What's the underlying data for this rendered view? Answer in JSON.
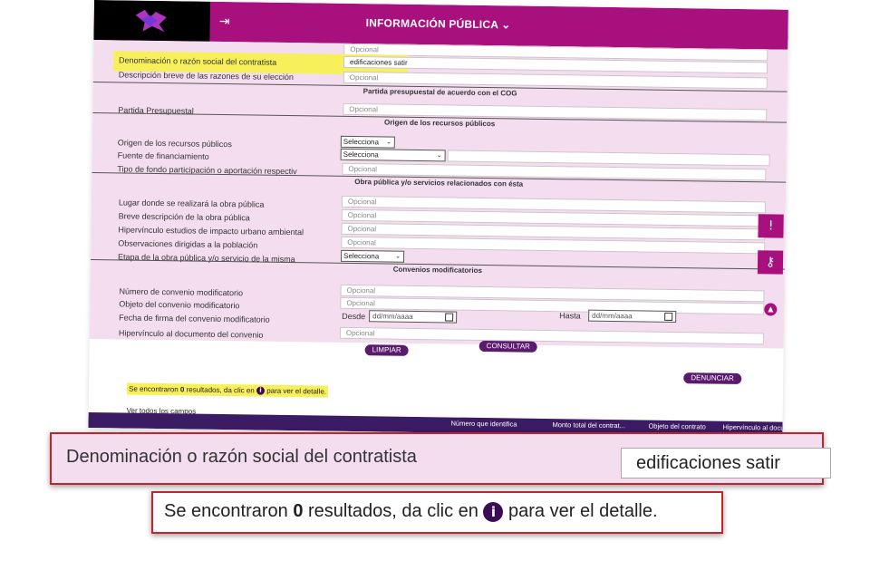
{
  "header": {
    "title": "INFORMACIÓN PÚBLICA",
    "title_chevron": "⌄",
    "login_icon": "login-icon",
    "logo_icon": "logo-icon"
  },
  "form": {
    "first_row_placeholder": "Opcional",
    "contractor": {
      "label": "Denominación o razón social del contratista",
      "value": "edificaciones satir"
    },
    "reasons": {
      "label": "Descripción breve de las razones de su elección",
      "placeholder": "Opcional"
    },
    "budget_section": "Partida presupuestal de acuerdo con el COG",
    "budget": {
      "label": "Partida Presupuestal",
      "placeholder": "Opcional"
    },
    "origin_section": "Origen de los recursos públicos",
    "origin": {
      "label": "Origen de los recursos públicos",
      "selected": "Selecciona"
    },
    "funding": {
      "label": "Fuente de financiamiento",
      "selected": "Selecciona"
    },
    "fund_type": {
      "label": "Tipo de fondo participación o aportación respectiv",
      "placeholder": "Opcional"
    },
    "works_section": "Obra pública y/o servicios relacionados con ésta",
    "location": {
      "label": "Lugar donde se realizará la obra pública",
      "placeholder": "Opcional"
    },
    "work_desc": {
      "label": "Breve descripción de la obra pública",
      "placeholder": "Opcional"
    },
    "impact": {
      "label": "Hipervínculo estudios de impacto urbano ambiental",
      "placeholder": "Opcional"
    },
    "observations": {
      "label": "Observaciones dirigidas a la población",
      "placeholder": "Opcional"
    },
    "stage": {
      "label": "Etapa de la obra pública y/o servicio de la misma",
      "selected": "Selecciona"
    },
    "agreements_section": "Convenios modificatorios",
    "agreement_no": {
      "label": "Número de convenio modificatorio",
      "placeholder": "Opcional"
    },
    "agreement_obj": {
      "label": "Objeto del convenio modificatorio",
      "placeholder": "Opcional"
    },
    "agreement_date": {
      "label": "Fecha de firma del convenio modificatorio",
      "from_label": "Desde",
      "to_label": "Hasta",
      "date_placeholder": "dd/mm/aaaa"
    },
    "agreement_link": {
      "label": "Hipervínculo al documento del convenio",
      "placeholder": "Opcional"
    }
  },
  "actions": {
    "clear": "LIMPIAR",
    "search": "CONSULTAR",
    "report": "DENUNCIAR"
  },
  "results": {
    "prefix": "Se encontraron ",
    "count": "0",
    "middle": " resultados, da clic en ",
    "info_glyph": "i",
    "suffix": " para ver el detalle.",
    "view_all": "Ver todos los campos"
  },
  "table_headers": [
    "Número que identifica",
    "Monto total del contrat...",
    "Objeto del contrato",
    "Hipervínculo al docu"
  ],
  "side_buttons": {
    "alert_glyph": "!",
    "key_glyph": "⚷",
    "up_glyph": "▲"
  },
  "zoom_callouts": {
    "contractor_label": "Denominación o razón social del contratista",
    "contractor_value": "edificaciones satir"
  },
  "colors": {
    "brand": "#a8107e",
    "dark_purple": "#3b0c55",
    "highlight": "#f7f05a",
    "callout_border": "#c0242c",
    "form_bg": "#f3ddef"
  }
}
